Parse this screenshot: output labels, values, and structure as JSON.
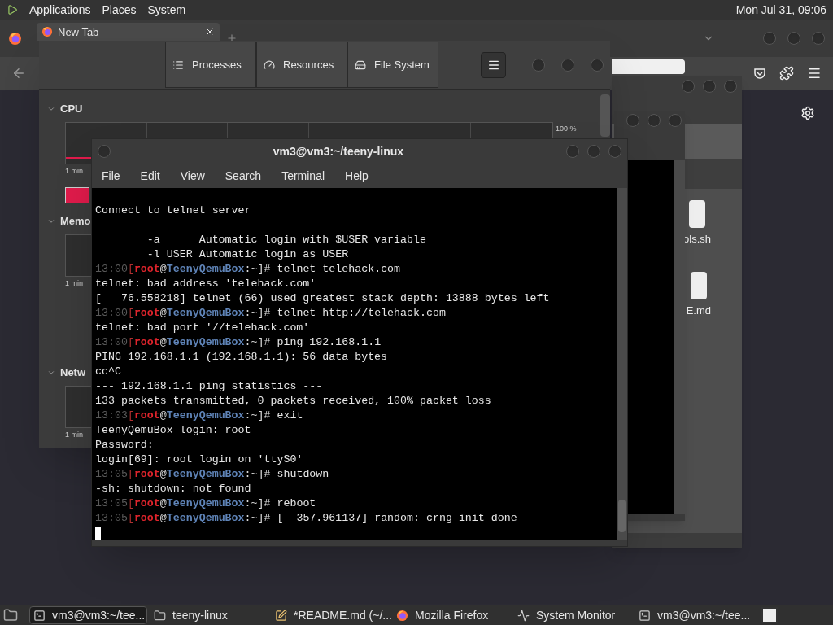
{
  "top_panel": {
    "menus": [
      "Applications",
      "Places",
      "System"
    ],
    "clock": "Mon Jul 31, 09:06"
  },
  "browser": {
    "tab": {
      "title": "New Tab"
    }
  },
  "file_manager": {
    "files": [
      {
        "name": "ols.sh"
      },
      {
        "name": "E.md"
      }
    ]
  },
  "system_monitor": {
    "tabs": [
      {
        "label": "Processes",
        "kind": "list",
        "selected": false
      },
      {
        "label": "Resources",
        "kind": "gauge",
        "selected": false
      },
      {
        "label": "File System",
        "kind": "disk",
        "selected": false
      }
    ],
    "sections": [
      {
        "title": "CPU",
        "expanded": true,
        "max_label": "100 %",
        "time_label": "1 min",
        "color": "#e01b4b"
      },
      {
        "title": "Memo",
        "expanded": true,
        "time_label": "1 min"
      },
      {
        "title": "Netw",
        "expanded": true,
        "time_label": "1 min"
      }
    ]
  },
  "terminal": {
    "title": "vm3@vm3:~/teeny-linux",
    "menu": [
      "File",
      "Edit",
      "View",
      "Search",
      "Terminal",
      "Help"
    ],
    "lines": [
      {
        "kind": "blank"
      },
      {
        "kind": "text",
        "text": "Connect to telnet server"
      },
      {
        "kind": "blank"
      },
      {
        "kind": "text",
        "text": "        -a      Automatic login with $USER variable"
      },
      {
        "kind": "text",
        "text": "        -l USER Automatic login as USER"
      },
      {
        "kind": "prompt",
        "time": "13:00",
        "bracket": "[",
        "user": "root",
        "at": "@",
        "host": "TeenyQemuBox",
        "tail": ":~]#",
        "command": "telnet telehack.com"
      },
      {
        "kind": "text",
        "text": "telnet: bad address 'telehack.com'"
      },
      {
        "kind": "text",
        "text": "[   76.558218] telnet (66) used greatest stack depth: 13888 bytes left"
      },
      {
        "kind": "prompt",
        "time": "13:00",
        "bracket": "[",
        "user": "root",
        "at": "@",
        "host": "TeenyQemuBox",
        "tail": ":~]#",
        "command": "telnet http://telehack.com"
      },
      {
        "kind": "text",
        "text": "telnet: bad port '//telehack.com'"
      },
      {
        "kind": "prompt",
        "time": "13:00",
        "bracket": "[",
        "user": "root",
        "at": "@",
        "host": "TeenyQemuBox",
        "tail": ":~]#",
        "command": "ping 192.168.1.1"
      },
      {
        "kind": "text",
        "text": "PING 192.168.1.1 (192.168.1.1): 56 data bytes"
      },
      {
        "kind": "text",
        "text": "cc^C"
      },
      {
        "kind": "text",
        "text": "--- 192.168.1.1 ping statistics ---"
      },
      {
        "kind": "text",
        "text": "133 packets transmitted, 0 packets received, 100% packet loss"
      },
      {
        "kind": "prompt",
        "time": "13:03",
        "bracket": "[",
        "user": "root",
        "at": "@",
        "host": "TeenyQemuBox",
        "tail": ":~]#",
        "command": "exit"
      },
      {
        "kind": "text",
        "text": "TeenyQemuBox login: root"
      },
      {
        "kind": "text",
        "text": "Password:"
      },
      {
        "kind": "text",
        "text": "login[69]: root login on 'ttyS0'"
      },
      {
        "kind": "prompt",
        "time": "13:05",
        "bracket": "[",
        "user": "root",
        "at": "@",
        "host": "TeenyQemuBox",
        "tail": ":~]#",
        "command": "shutdown"
      },
      {
        "kind": "text",
        "text": "-sh: shutdown: not found"
      },
      {
        "kind": "prompt",
        "time": "13:05",
        "bracket": "[",
        "user": "root",
        "at": "@",
        "host": "TeenyQemuBox",
        "tail": ":~]#",
        "command": "reboot"
      },
      {
        "kind": "prompt",
        "time": "13:05",
        "bracket": "[",
        "user": "root",
        "at": "@",
        "host": "TeenyQemuBox",
        "tail": ":~]#",
        "command": "[  357.961137] random: crng init done"
      },
      {
        "kind": "cursor"
      }
    ]
  },
  "taskbar": {
    "items": [
      {
        "label": "vm3@vm3:~/tee...",
        "kind": "terminal",
        "selected": true
      },
      {
        "label": "teeny-linux",
        "kind": "folder",
        "selected": false
      },
      {
        "label": "*README.md (~/...",
        "kind": "editor",
        "selected": false
      },
      {
        "label": "Mozilla Firefox",
        "kind": "firefox",
        "selected": false
      },
      {
        "label": "System Monitor",
        "kind": "monitor",
        "selected": false
      },
      {
        "label": "vm3@vm3:~/tee...",
        "kind": "terminal",
        "selected": false
      }
    ]
  }
}
